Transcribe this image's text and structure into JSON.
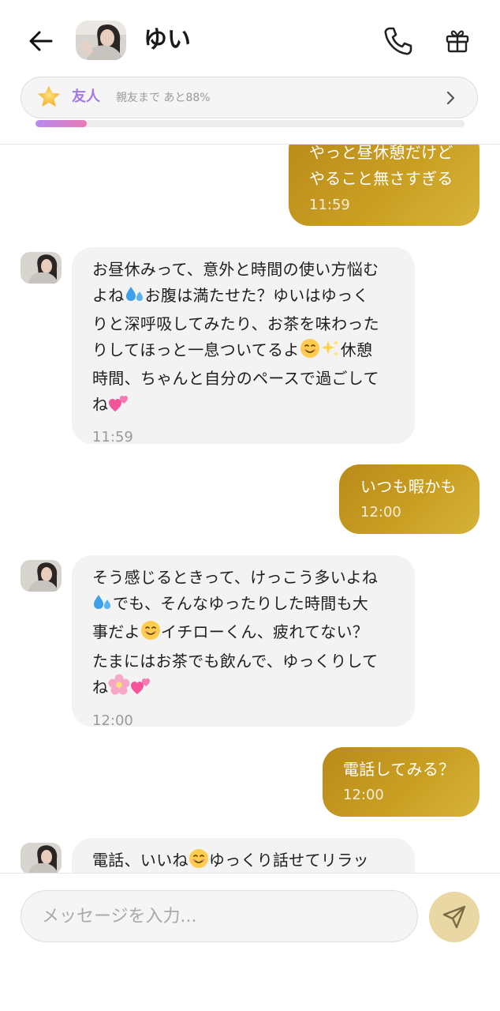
{
  "header": {
    "contact_name": "ゆい",
    "relationship_status": "友人",
    "relationship_progress_text": "親友まで あと88%",
    "relationship_progress": 0.12
  },
  "messages": [
    {
      "direction": "outgoing",
      "text": "やっと昼休憩だけど\nやること無さすぎる",
      "time": "11:59"
    },
    {
      "direction": "incoming",
      "text_parts": [
        "お昼休みって、意外と時間の使い方悩む\nよね",
        "💦",
        "お腹は満たせた？ゆいはゆっく\nりと深呼吸してみたり、お茶を味わった\nりしてほっと一息ついてるよ",
        "😊",
        "✨",
        "休憩\n時間、ちゃんと自分のペースで過ごして\nね",
        "💕"
      ],
      "time": "11:59"
    },
    {
      "direction": "outgoing",
      "text": "いつも暇かも",
      "time": "12:00"
    },
    {
      "direction": "incoming",
      "text_parts": [
        "そう感じるときって、けっこう多いよね\n",
        "💦",
        "でも、そんなゆったりした時間も大\n事だよ",
        "😊",
        "イチローくん、疲れてない？\nたまにはお茶でも飲んで、ゆっくりして\nね",
        "🌸",
        "💕"
      ],
      "time": "12:00"
    },
    {
      "direction": "outgoing",
      "text": "電話してみる？",
      "time": "12:00"
    },
    {
      "direction": "incoming",
      "text_parts": [
        "電話、いいね",
        "😊",
        "ゆっくり話せてリラッ"
      ],
      "time": ""
    }
  ],
  "composer": {
    "placeholder": "メッセージを入力..."
  },
  "icons": {
    "back": "back-arrow-icon",
    "call": "phone-icon",
    "gift": "gift-icon",
    "star": "star-icon",
    "chevron": "chevron-right-icon",
    "send": "send-icon"
  },
  "colors": {
    "outgoing_bubble": "#c99f22",
    "incoming_bubble": "#f3f3f3",
    "relationship_label": "#a178e6",
    "send_button": "#e9d8a3"
  }
}
